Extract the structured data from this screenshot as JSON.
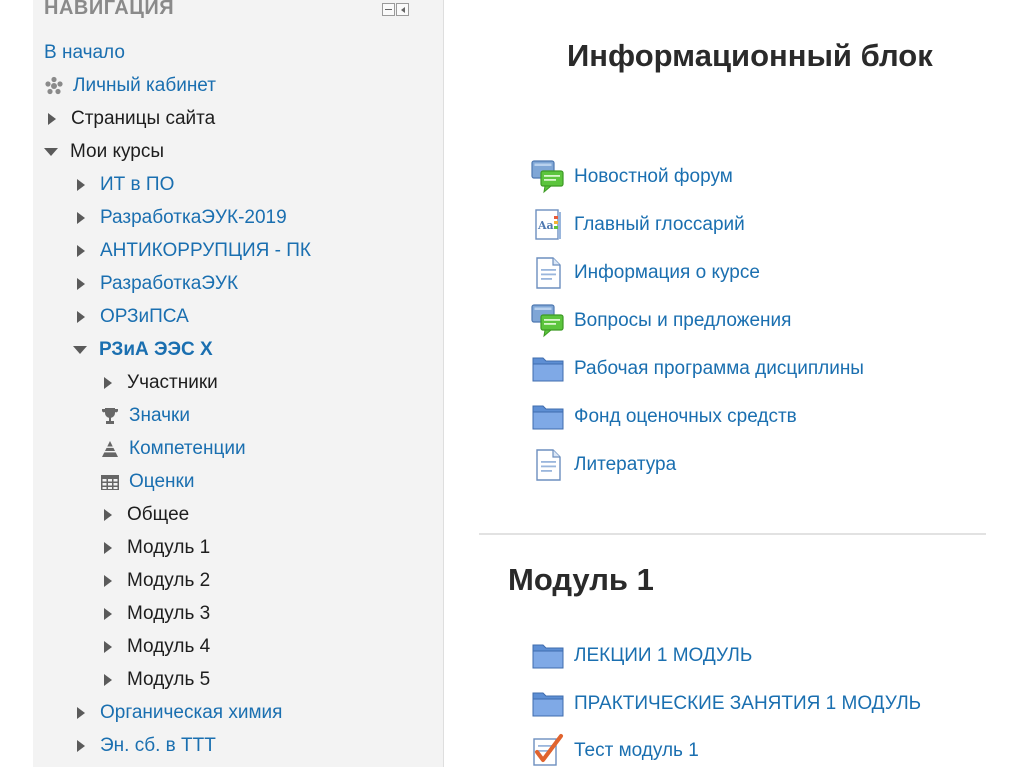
{
  "sidebar": {
    "header": "НАВИГАЦИЯ",
    "items": [
      {
        "label": "В начало",
        "kind": "link",
        "icon": "none",
        "indent": 0
      },
      {
        "label": "Личный кабинет",
        "kind": "link",
        "icon": "dashboard-icon",
        "indent": 0
      },
      {
        "label": "Страницы сайта",
        "kind": "text",
        "icon": "collapsed-triangle-icon",
        "indent": 0
      },
      {
        "label": "Мои курсы",
        "kind": "text",
        "icon": "expanded-triangle-icon",
        "indent": 0
      },
      {
        "label": "ИТ в ПО",
        "kind": "link",
        "icon": "collapsed-triangle-icon",
        "indent": 1
      },
      {
        "label": "РазработкаЭУК-2019",
        "kind": "link",
        "icon": "collapsed-triangle-icon",
        "indent": 1
      },
      {
        "label": "АНТИКОРРУПЦИЯ - ПК",
        "kind": "link",
        "icon": "collapsed-triangle-icon",
        "indent": 1
      },
      {
        "label": "РазработкаЭУК",
        "kind": "link",
        "icon": "collapsed-triangle-icon",
        "indent": 1
      },
      {
        "label": "ОРЗиПСА",
        "kind": "link",
        "icon": "collapsed-triangle-icon",
        "indent": 1
      },
      {
        "label": "РЗиА ЭЭС Х",
        "kind": "active",
        "icon": "expanded-triangle-icon",
        "indent": 1
      },
      {
        "label": "Участники",
        "kind": "text",
        "icon": "collapsed-triangle-icon",
        "indent": 2
      },
      {
        "label": "Значки",
        "kind": "link",
        "icon": "trophy-icon",
        "indent": 2
      },
      {
        "label": "Компетенции",
        "kind": "link",
        "icon": "competencies-icon",
        "indent": 2
      },
      {
        "label": "Оценки",
        "kind": "link",
        "icon": "grades-table-icon",
        "indent": 2
      },
      {
        "label": "Общее",
        "kind": "text",
        "icon": "collapsed-triangle-icon",
        "indent": 2
      },
      {
        "label": "Модуль 1",
        "kind": "text",
        "icon": "collapsed-triangle-icon",
        "indent": 2
      },
      {
        "label": "Модуль 2",
        "kind": "text",
        "icon": "collapsed-triangle-icon",
        "indent": 2
      },
      {
        "label": "Модуль 3",
        "kind": "text",
        "icon": "collapsed-triangle-icon",
        "indent": 2
      },
      {
        "label": "Модуль 4",
        "kind": "text",
        "icon": "collapsed-triangle-icon",
        "indent": 2
      },
      {
        "label": "Модуль 5",
        "kind": "text",
        "icon": "collapsed-triangle-icon",
        "indent": 2
      },
      {
        "label": "Органическая химия",
        "kind": "link",
        "icon": "collapsed-triangle-icon",
        "indent": 1
      },
      {
        "label": "Эн. сб. в ТТТ",
        "kind": "link",
        "icon": "collapsed-triangle-icon",
        "indent": 1
      }
    ]
  },
  "main": {
    "info_block": {
      "title": "Информационный блок",
      "activities": [
        {
          "label": "Новостной форум",
          "icon": "forum-icon"
        },
        {
          "label": "Главный глоссарий",
          "icon": "glossary-icon"
        },
        {
          "label": "Информация о курсе",
          "icon": "page-icon"
        },
        {
          "label": "Вопросы и предложения",
          "icon": "forum-icon"
        },
        {
          "label": "Рабочая программа дисциплины",
          "icon": "folder-icon"
        },
        {
          "label": "Фонд оценочных средств",
          "icon": "folder-icon"
        },
        {
          "label": "Литература",
          "icon": "page-icon"
        }
      ]
    },
    "module1": {
      "title": "Модуль 1",
      "activities": [
        {
          "label": "ЛЕКЦИИ 1 МОДУЛЬ",
          "icon": "folder-icon"
        },
        {
          "label": "ПРАКТИЧЕСКИЕ ЗАНЯТИЯ 1 МОДУЛЬ",
          "icon": "folder-icon"
        },
        {
          "label": "Тест модуль 1",
          "icon": "quiz-icon"
        }
      ]
    }
  },
  "colors": {
    "link": "#1a6fb0",
    "text": "#1e1e1e",
    "sidebar_bg": "#f3f3f3",
    "header_text": "#8a8a8a"
  }
}
